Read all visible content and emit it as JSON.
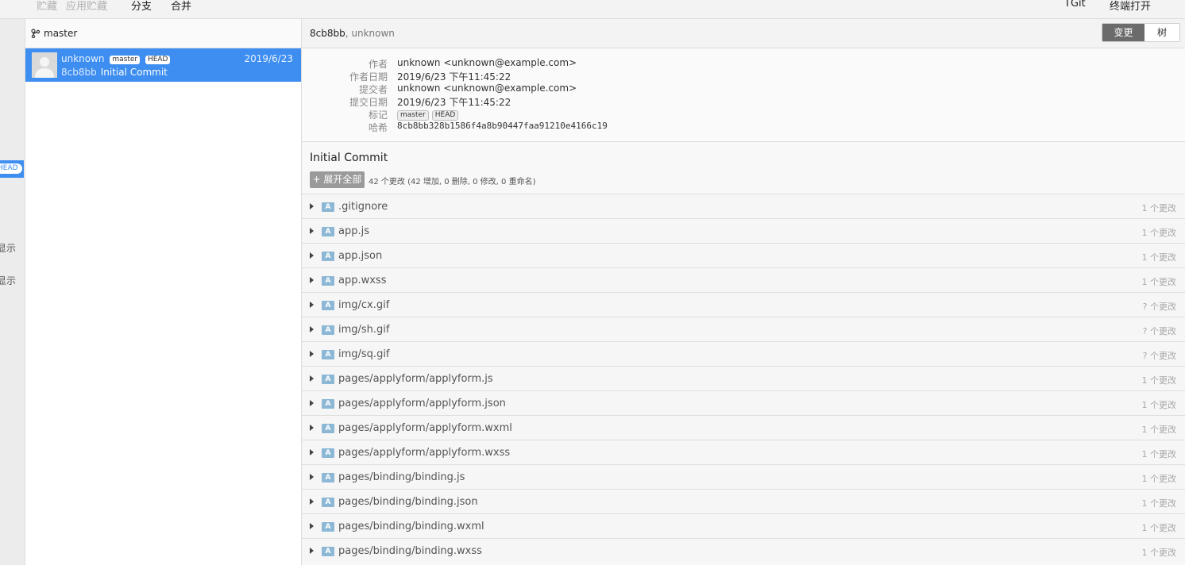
{
  "toolbar": {
    "items": [
      "贮藏",
      "应用贮藏",
      "分支",
      "合并"
    ],
    "right_items": [
      "TGit",
      "终端打开"
    ]
  },
  "leftbar": {
    "head_badge": "HEAD",
    "labels": [
      "显示",
      "显示"
    ]
  },
  "branch": {
    "name": "master"
  },
  "commit": {
    "author": "unknown",
    "tags": [
      "master",
      "HEAD"
    ],
    "date": "2019/6/23",
    "short_hash": "8cb8bb",
    "message": "Initial Commit"
  },
  "detail_header": {
    "hash": "8cb8bb",
    "author": "unknown",
    "tabs": [
      "变更",
      "树"
    ]
  },
  "meta": {
    "author_label": "作者",
    "author_value": "unknown <unknown@example.com>",
    "author_date_label": "作者日期",
    "author_date_value": "2019/6/23 下午11:45:22",
    "committer_label": "提交者",
    "committer_value": "unknown <unknown@example.com>",
    "commit_date_label": "提交日期",
    "commit_date_value": "2019/6/23 下午11:45:22",
    "tags_label": "标记",
    "tags": [
      "master",
      "HEAD"
    ],
    "hash_label": "哈希",
    "hash_value": "8cb8bb328b1586f4a8b90447faa91210e4166c19"
  },
  "message_title": "Initial Commit",
  "expand_label": "+ 展开全部",
  "summary": "42 个更改 (42 增加, 0 删除, 0 修改, 0 重命名)",
  "status_letter": "A",
  "files": [
    {
      "name": ".gitignore",
      "changes": "1 个更改"
    },
    {
      "name": "app.js",
      "changes": "1 个更改"
    },
    {
      "name": "app.json",
      "changes": "1 个更改"
    },
    {
      "name": "app.wxss",
      "changes": "1 个更改"
    },
    {
      "name": "img/cx.gif",
      "changes": "? 个更改"
    },
    {
      "name": "img/sh.gif",
      "changes": "? 个更改"
    },
    {
      "name": "img/sq.gif",
      "changes": "? 个更改"
    },
    {
      "name": "pages/applyform/applyform.js",
      "changes": "1 个更改"
    },
    {
      "name": "pages/applyform/applyform.json",
      "changes": "1 个更改"
    },
    {
      "name": "pages/applyform/applyform.wxml",
      "changes": "1 个更改"
    },
    {
      "name": "pages/applyform/applyform.wxss",
      "changes": "1 个更改"
    },
    {
      "name": "pages/binding/binding.js",
      "changes": "1 个更改"
    },
    {
      "name": "pages/binding/binding.json",
      "changes": "1 个更改"
    },
    {
      "name": "pages/binding/binding.wxml",
      "changes": "1 个更改"
    },
    {
      "name": "pages/binding/binding.wxss",
      "changes": "1 个更改"
    }
  ]
}
